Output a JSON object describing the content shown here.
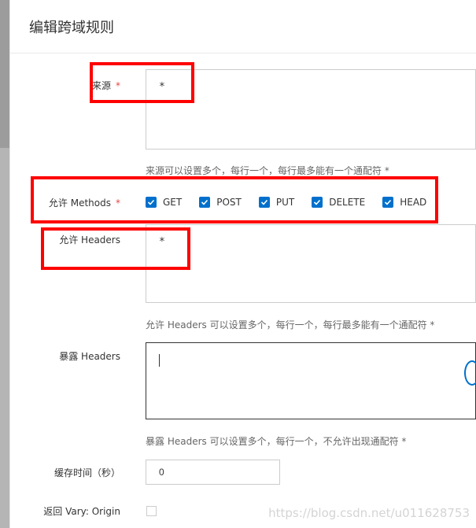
{
  "dialog": {
    "title": "编辑跨域规则"
  },
  "origin": {
    "label": "来源",
    "required": "*",
    "value": "*",
    "hint": "来源可以设置多个，每行一个，每行最多能有一个通配符 *"
  },
  "methods": {
    "label": "允许 Methods",
    "required": "*",
    "options": [
      {
        "label": "GET",
        "checked": true
      },
      {
        "label": "POST",
        "checked": true
      },
      {
        "label": "PUT",
        "checked": true
      },
      {
        "label": "DELETE",
        "checked": true
      },
      {
        "label": "HEAD",
        "checked": true
      }
    ]
  },
  "allow_headers": {
    "label": "允许 Headers",
    "value": "*",
    "hint": "允许 Headers 可以设置多个，每行一个，每行最多能有一个通配符 *"
  },
  "expose_headers": {
    "label": "暴露 Headers",
    "value": "",
    "hint": "暴露 Headers 可以设置多个，每行一个，不允许出现通配符 *"
  },
  "cache_time": {
    "label": "缓存时间（秒）",
    "value": "0"
  },
  "vary_origin": {
    "label": "返回 Vary: Origin",
    "checked": false
  },
  "watermark": "https://blog.csdn.net/u011628753",
  "colors": {
    "accent": "#0070cc",
    "annotation": "#ff0000",
    "required": "#e54545"
  }
}
